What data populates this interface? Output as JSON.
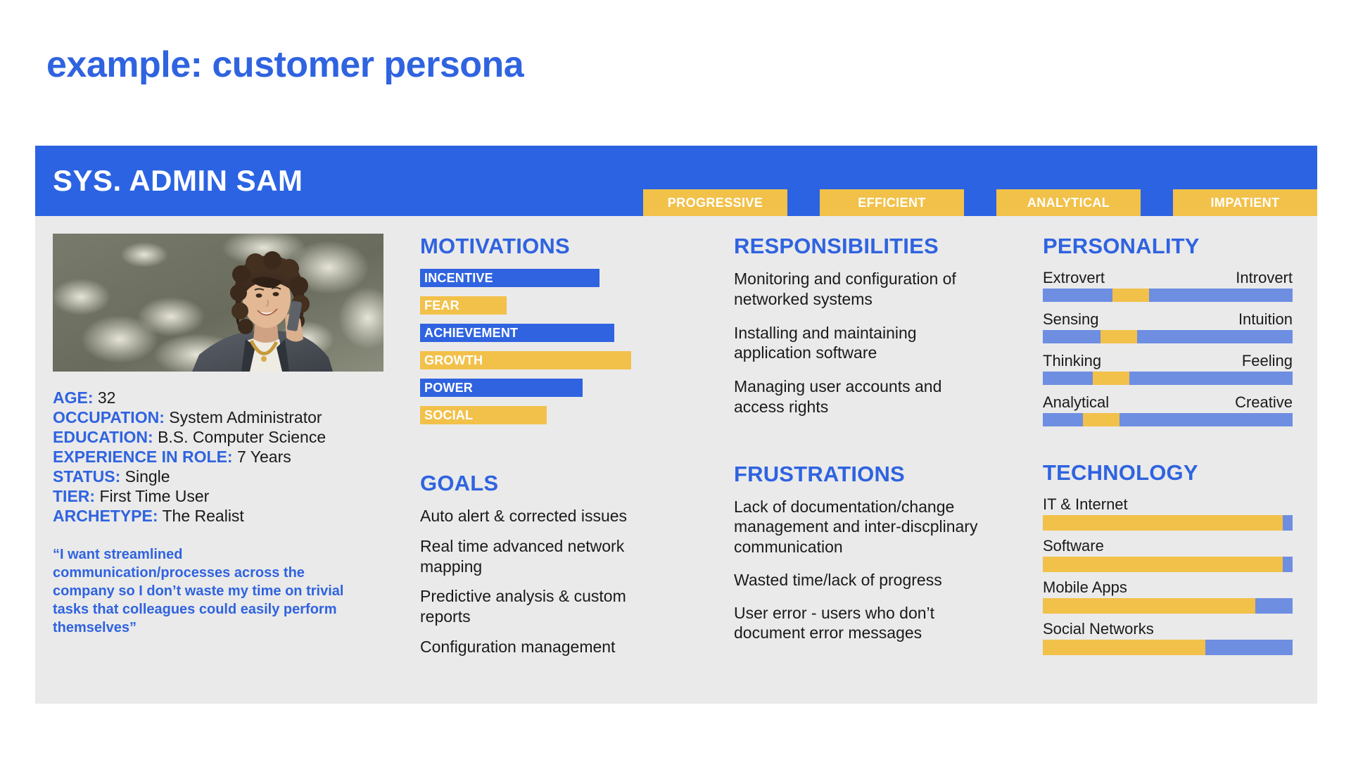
{
  "page": {
    "title": "example: customer persona"
  },
  "colors": {
    "brand_blue": "#2f63e0",
    "header_blue": "#2b63e2",
    "accent_yellow": "#f2c14a",
    "slider_blue": "#6e8ee2",
    "panel_gray": "#eaeaea"
  },
  "persona": {
    "name": "SYS. ADMIN SAM",
    "tags": [
      "PROGRESSIVE",
      "EFFICIENT",
      "ANALYTICAL",
      "IMPATIENT"
    ],
    "photo_alt": "smiling woman with curly hair talking on mobile phone",
    "demographics": [
      {
        "label": "AGE:",
        "value": "32"
      },
      {
        "label": "OCCUPATION:",
        "value": "System Administrator"
      },
      {
        "label": "EDUCATION:",
        "value": "B.S. Computer Science"
      },
      {
        "label": "EXPERIENCE IN ROLE:",
        "value": "7 Years"
      },
      {
        "label": "STATUS:",
        "value": "Single"
      },
      {
        "label": "TIER:",
        "value": "First Time User"
      },
      {
        "label": "ARCHETYPE:",
        "value": "The Realist"
      }
    ],
    "quote": "“I want streamlined communication/processes across the company so I don’t waste my time on trivial tasks that colleagues could easily perform themselves”"
  },
  "sections": {
    "motivations": {
      "title": "MOTIVATIONS",
      "items": [
        {
          "label": "INCENTIVE",
          "value": 85,
          "color": "blue"
        },
        {
          "label": "FEAR",
          "value": 41,
          "color": "yellow"
        },
        {
          "label": "ACHIEVEMENT",
          "value": 92,
          "color": "blue"
        },
        {
          "label": "GROWTH",
          "value": 100,
          "color": "yellow"
        },
        {
          "label": "POWER",
          "value": 77,
          "color": "blue"
        },
        {
          "label": "SOCIAL",
          "value": 60,
          "color": "yellow"
        }
      ]
    },
    "goals": {
      "title": "GOALS",
      "items": [
        "Auto alert & corrected issues",
        "Real time advanced network mapping",
        "Predictive analysis & custom reports",
        "Configuration management"
      ]
    },
    "responsibilities": {
      "title": "RESPONSIBILITIES",
      "items": [
        "Monitoring and configuration of networked systems",
        "Installing and maintaining application software",
        "Managing user accounts and access rights"
      ]
    },
    "frustrations": {
      "title": "FRUSTRATIONS",
      "items": [
        "Lack of documentation/change management and inter-discplinary communication",
        "Wasted time/lack of progress",
        "User error - users who don’t document error messages"
      ]
    },
    "personality": {
      "title": "PERSONALITY",
      "items": [
        {
          "left": "Extrovert",
          "right": "Introvert",
          "position": 28
        },
        {
          "left": "Sensing",
          "right": "Intuition",
          "position": 23
        },
        {
          "left": "Thinking",
          "right": "Feeling",
          "position": 20
        },
        {
          "left": "Analytical",
          "right": "Creative",
          "position": 16
        }
      ]
    },
    "technology": {
      "title": "TECHNOLOGY",
      "items": [
        {
          "label": "IT & Internet",
          "value": 96
        },
        {
          "label": "Software",
          "value": 96
        },
        {
          "label": "Mobile Apps",
          "value": 85
        },
        {
          "label": "Social Networks",
          "value": 65
        }
      ]
    }
  },
  "chart_data": [
    {
      "type": "bar",
      "title": "MOTIVATIONS",
      "orientation": "horizontal",
      "categories": [
        "INCENTIVE",
        "FEAR",
        "ACHIEVEMENT",
        "GROWTH",
        "POWER",
        "SOCIAL"
      ],
      "values": [
        85,
        41,
        92,
        100,
        77,
        60
      ],
      "xlabel": "",
      "ylabel": "",
      "xlim": [
        0,
        100
      ],
      "grid": false,
      "legend": false,
      "series_colors": [
        "#2f63e0",
        "#f2c14a",
        "#2f63e0",
        "#f2c14a",
        "#2f63e0",
        "#f2c14a"
      ]
    },
    {
      "type": "bar",
      "title": "PERSONALITY",
      "orientation": "horizontal",
      "note": "bipolar sliders; value = marker position along 0-100 track",
      "categories": [
        "Extrovert – Introvert",
        "Sensing – Intuition",
        "Thinking – Feeling",
        "Analytical – Creative"
      ],
      "values": [
        28,
        23,
        20,
        16
      ],
      "xlim": [
        0,
        100
      ],
      "grid": false,
      "legend": false
    },
    {
      "type": "bar",
      "title": "TECHNOLOGY",
      "orientation": "horizontal",
      "categories": [
        "IT & Internet",
        "Software",
        "Mobile Apps",
        "Social Networks"
      ],
      "values": [
        96,
        96,
        85,
        65
      ],
      "xlim": [
        0,
        100
      ],
      "grid": false,
      "legend": false,
      "series_colors": [
        "#f2c14a",
        "#f2c14a",
        "#f2c14a",
        "#f2c14a"
      ]
    }
  ]
}
